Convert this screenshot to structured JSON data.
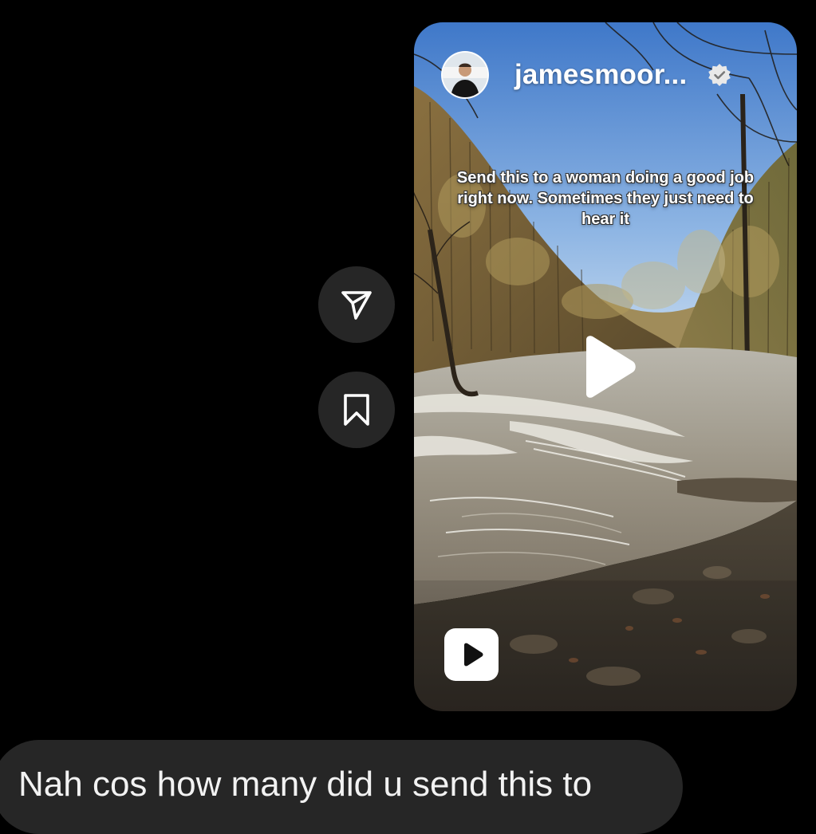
{
  "shared_reel": {
    "username": "jamesmoor...",
    "verified": true,
    "caption": "Send this to a woman doing a good job right now. Sometimes they just need to hear it",
    "badge_icon": "reel-icon",
    "center_icon": "play-icon"
  },
  "actions": {
    "share_icon": "send-icon",
    "save_icon": "bookmark-icon"
  },
  "message": {
    "text": "Nah cos how many did u send this to"
  },
  "colors": {
    "background": "#000000",
    "action_button": "#262626",
    "bubble": "#262626",
    "text": "#f2f2f2"
  }
}
